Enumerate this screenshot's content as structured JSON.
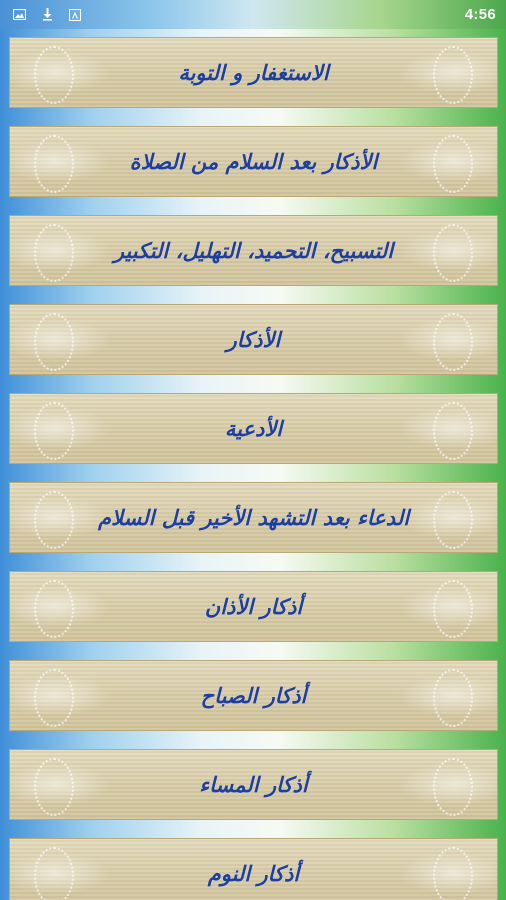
{
  "status_bar": {
    "time": "4:56",
    "icons": [
      "image-icon",
      "download-icon",
      "text-icon"
    ]
  },
  "menu": {
    "items": [
      {
        "label": "الاستغفار و التوبة"
      },
      {
        "label": "الأذكار بعد السلام من الصلاة"
      },
      {
        "label": "التسبيح، التحميد، التهليل، التكبير"
      },
      {
        "label": "الأذكار"
      },
      {
        "label": "الأدعية"
      },
      {
        "label": "الدعاء بعد التشهد الأخير قبل السلام"
      },
      {
        "label": "أذكار الأذان"
      },
      {
        "label": "أذكار الصباح"
      },
      {
        "label": "أذكار المساء"
      },
      {
        "label": "أذكار النوم"
      }
    ]
  }
}
